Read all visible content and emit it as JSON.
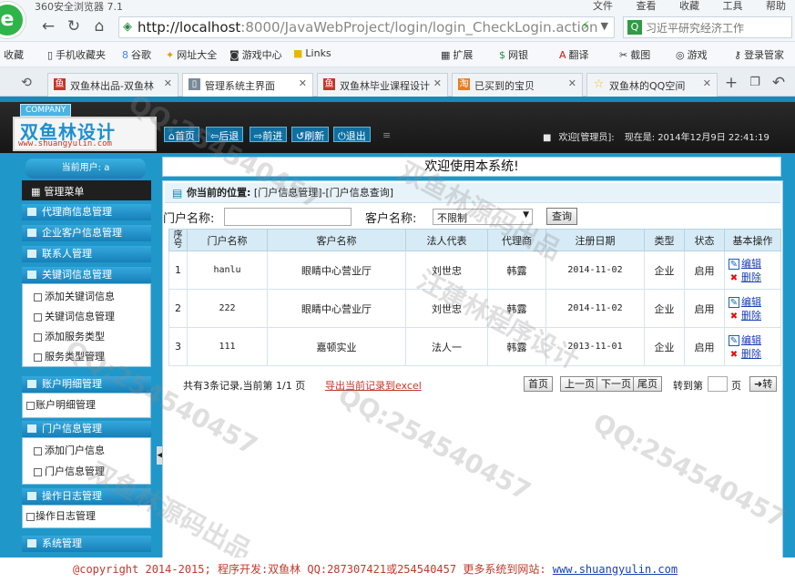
{
  "browser": {
    "title": "360安全浏览器 7.1",
    "menus": [
      "文件",
      "查看",
      "收藏",
      "工具",
      "帮助"
    ],
    "logo_glyph": "e",
    "url_host": "http://localhost",
    "url_rest": ":8000/JavaWebProject/login/login_CheckLogin.action",
    "search_text": "习近平研究经济工作",
    "favorites": [
      "收藏",
      "手机收藏夹",
      "谷歌",
      "网址大全",
      "游戏中心",
      "Links",
      "扩展",
      "网银",
      "翻译",
      "截图",
      "游戏",
      "登录管家"
    ],
    "tabs": [
      {
        "label": "双鱼林出品-双鱼林",
        "icon_color": "#c0392b"
      },
      {
        "label": "管理系统主界面",
        "icon_color": "#7a8a99"
      },
      {
        "label": "双鱼林毕业课程设计",
        "icon_color": "#c0392b"
      },
      {
        "label": "已买到的宝贝",
        "icon_color": "#e67e22"
      },
      {
        "label": "双鱼林的QQ空间",
        "icon_color": "#f1c40f"
      }
    ]
  },
  "header": {
    "company_tag": "COMPANY",
    "brand_main": "双鱼林设计",
    "brand_sub": "www.shuangyulin.com",
    "nav": [
      "首页",
      "后退",
      "前进",
      "刷新",
      "退出"
    ],
    "welcome_user": "欢迎[管理员]:",
    "now_label": "现在是:",
    "now_value": "2014年12月9日 22:41:19"
  },
  "sidebar": {
    "current_user": "当前用户: a",
    "menu_title": "管理菜单",
    "groups": [
      {
        "label": "代理商信息管理",
        "items": []
      },
      {
        "label": "企业客户信息管理",
        "items": []
      },
      {
        "label": "联系人管理",
        "items": []
      },
      {
        "label": "关键词信息管理",
        "items": [
          "添加关键词信息",
          "关键词信息管理",
          "添加服务类型",
          "服务类型管理"
        ]
      },
      {
        "label": "账户明细管理",
        "items": [
          "账户明细管理"
        ]
      },
      {
        "label": "门户信息管理",
        "items": [
          "添加门户信息",
          "门户信息管理"
        ]
      },
      {
        "label": "操作日志管理",
        "items": [
          "操作日志管理"
        ]
      },
      {
        "label": "系统管理",
        "items": []
      }
    ]
  },
  "main": {
    "welcome_title": "欢迎使用本系统!",
    "location_label": "你当前的位置:",
    "location_path": "[门户信息管理]-[门户信息查询]",
    "filter": {
      "shop_label": "门户名称:",
      "shop_value": "",
      "customer_label": "客户名称:",
      "customer_selected": "不限制",
      "query_button": "查询"
    },
    "table": {
      "columns": [
        "序号",
        "门户名称",
        "客户名称",
        "法人代表",
        "代理商",
        "注册日期",
        "类型",
        "状态",
        "基本操作"
      ],
      "rows": [
        {
          "no": "1",
          "name": "hanlu",
          "customer": "眼睛中心营业厅",
          "legal": "刘世忠",
          "agent": "韩露",
          "date": "2014-11-02",
          "type": "企业",
          "status": "启用"
        },
        {
          "no": "2",
          "name": "222",
          "customer": "眼睛中心营业厅",
          "legal": "刘世忠",
          "agent": "韩露",
          "date": "2014-11-02",
          "type": "企业",
          "status": "启用"
        },
        {
          "no": "3",
          "name": "111",
          "customer": "嘉顿实业",
          "legal": "法人一",
          "agent": "韩露",
          "date": "2013-11-01",
          "type": "企业",
          "status": "启用"
        }
      ],
      "edit_label": "编辑",
      "delete_label": "删除"
    },
    "pager": {
      "summary": "共有3条记录,当前第 1/1 页",
      "export": "导出当前记录到excel",
      "first": "首页",
      "prev": "上一页",
      "next": "下一页",
      "last": "尾页",
      "goto_label": "转到第",
      "page_word": "页",
      "go_button": "转"
    }
  },
  "footer": {
    "text": "@copyright 2014-2015; 程序开发:双鱼林  QQ:287307421或254540457  更多系统到网站:",
    "link": "www.shuangyulin.com"
  },
  "watermarks": [
    "QQ:254540457",
    "汪建林程序设计",
    "双鱼林源码出品"
  ]
}
